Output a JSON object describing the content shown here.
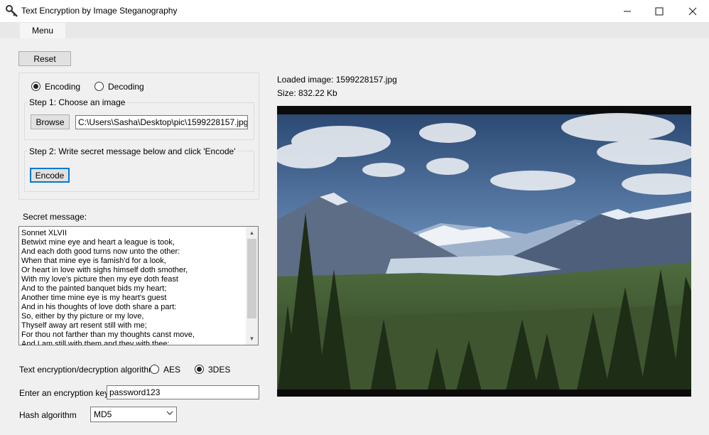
{
  "window": {
    "title": "Text Encryption by Image Steganography",
    "app_icon": "key-icon",
    "controls": {
      "minimize": "–",
      "maximize": "☐",
      "close": "✕"
    }
  },
  "menu": {
    "label": "Menu"
  },
  "reset_label": "Reset",
  "mode": {
    "options": [
      "Encoding",
      "Decoding"
    ],
    "selected": "Encoding"
  },
  "step1": {
    "label": "Step 1: Choose an image",
    "browse_label": "Browse",
    "path_value": "C:\\Users\\Sasha\\Desktop\\pic\\1599228157.jpg"
  },
  "step2": {
    "label": "Step 2: Write secret message below and click 'Encode'",
    "encode_label": "Encode"
  },
  "secret": {
    "label": "Secret message:",
    "lines": [
      "Sonnet XLVII",
      "Betwixt mine eye and heart a league is took,",
      "And each doth good turns now unto the other:",
      "When that mine eye is famish'd for a look,",
      "Or heart in love with sighs himself doth smother,",
      "With my love's picture then my eye doth feast",
      "And to the painted banquet bids my heart;",
      "Another time mine eye is my heart's guest",
      "And in his thoughts of love doth share a part:",
      "So, either by thy picture or my love,",
      "Thyself away art resent still with me;",
      "For thou not farther than my thoughts canst move,",
      "And I am still with them and they with thee;"
    ]
  },
  "algorithm": {
    "label": "Text encryption/decryption algorithm:",
    "options": [
      "AES",
      "3DES"
    ],
    "selected": "3DES"
  },
  "key": {
    "label": "Enter an encryption key:",
    "value": "password123"
  },
  "hash": {
    "label": "Hash algorithm",
    "selected": "MD5"
  },
  "image_info": {
    "loaded": "Loaded image: 1599228157.jpg",
    "size": "Size: 832.22 Kb"
  }
}
